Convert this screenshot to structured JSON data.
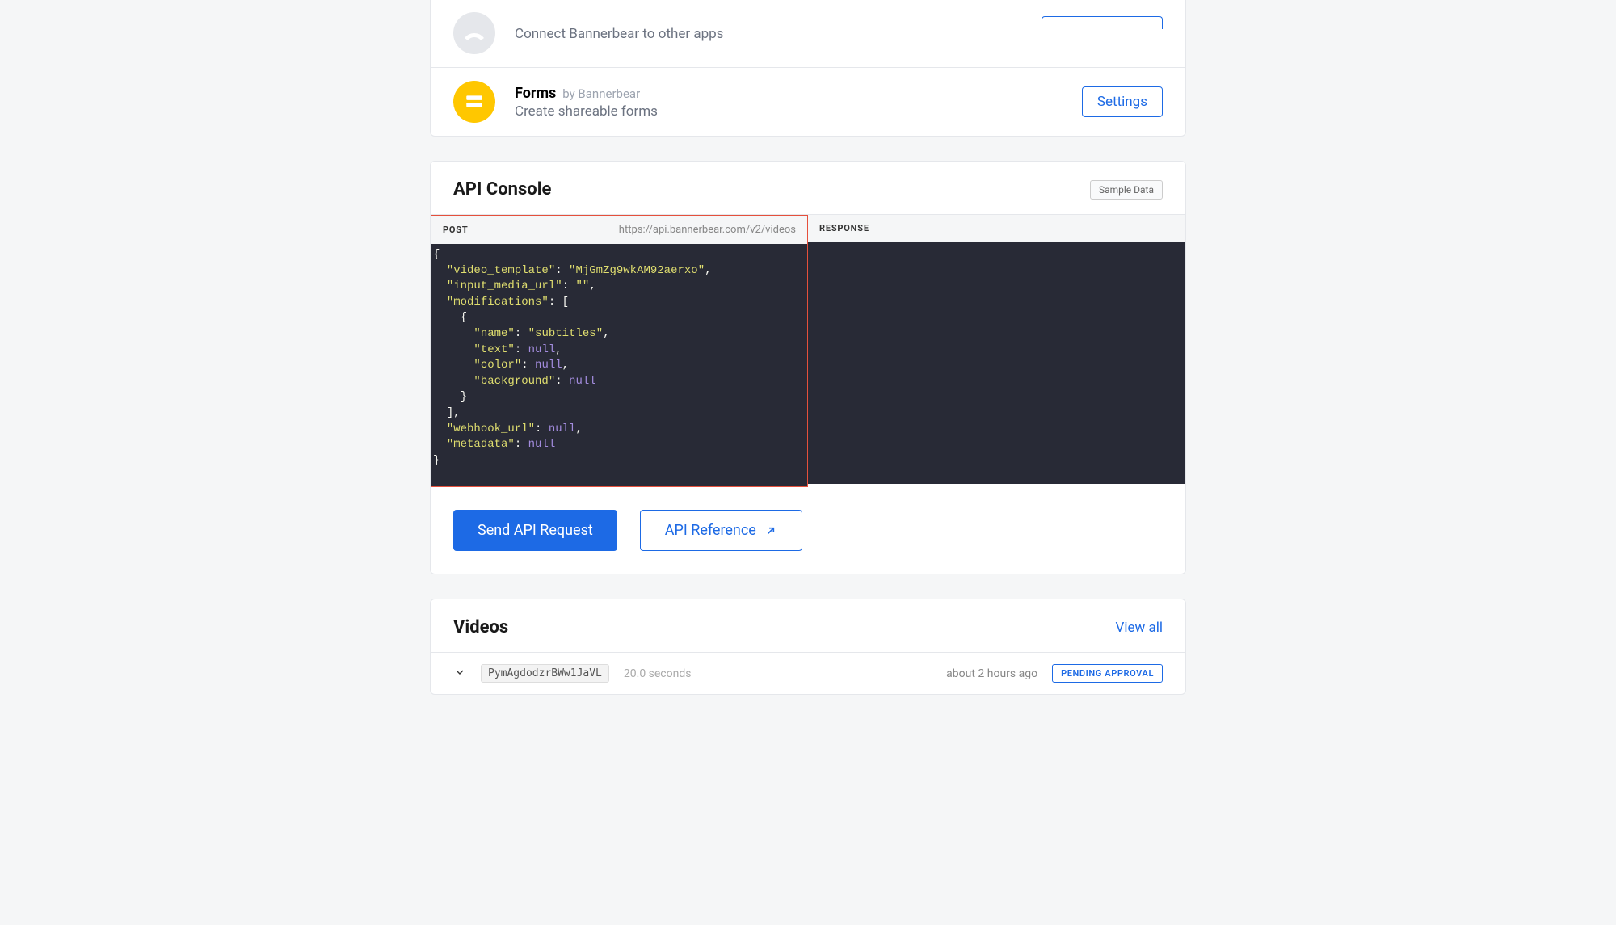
{
  "integrations": {
    "connect": {
      "subtitle": "Connect Bannerbear to other apps"
    },
    "forms": {
      "title": "Forms",
      "byline": "by Bannerbear",
      "subtitle": "Create shareable forms",
      "cta": "Settings"
    }
  },
  "api_console": {
    "title": "API Console",
    "sample_data_btn": "Sample Data",
    "request_label": "POST",
    "request_url": "https://api.bannerbear.com/v2/videos",
    "response_label": "RESPONSE",
    "body": {
      "video_template": "MjGmZg9wkAM92aerxo",
      "input_media_url": "",
      "modifications_name": "subtitles",
      "null_literal": "null"
    },
    "send_btn": "Send API Request",
    "ref_btn": "API Reference"
  },
  "videos": {
    "title": "Videos",
    "view_all": "View all",
    "items": [
      {
        "id": "PymAgdodzrBWw1JaVL",
        "duration": "20.0 seconds",
        "timeago": "about 2 hours ago",
        "status": "PENDING APPROVAL"
      }
    ]
  }
}
